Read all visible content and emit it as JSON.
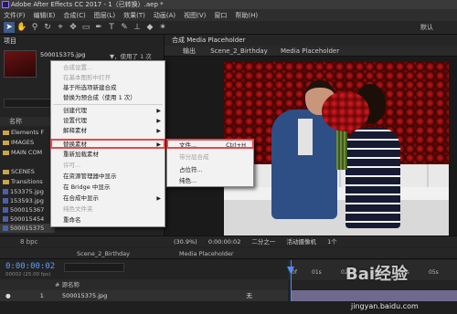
{
  "app": {
    "title": "Adobe After Effects CC 2017 - 1（已转换）.aep *"
  },
  "menu": [
    "文件(F)",
    "编辑(E)",
    "合成(C)",
    "图层(L)",
    "效果(T)",
    "动画(A)",
    "视图(V)",
    "窗口",
    "帮助(H)"
  ],
  "toolbar": {
    "workspace": "默认"
  },
  "project": {
    "tab": "项目",
    "item_name": "500015375.jpg",
    "item_usage": "▼，使用了 1 次",
    "column_name": "名称",
    "rows": [
      "Elements F",
      "IMAGES",
      "MAIN COM",
      "SCENES",
      "Transitions",
      "153375.jpg",
      "153593.jpg",
      "500015367",
      "500015454",
      "500015375"
    ],
    "footer_bpc": "8 bpc"
  },
  "composition": {
    "header": "合成 Media Placeholder",
    "sub_output": "输出",
    "sub_scene": "Scene_2_Birthday",
    "sub_media": "Media Placeholder",
    "footer_zoom": "(30.9%)",
    "footer_time": "0:00:00:02",
    "footer_quarter": "二分之一",
    "footer_camera": "活动摄像机",
    "footer_views": "1个"
  },
  "context_menu": {
    "items": [
      {
        "label": "合成设置...",
        "disabled": true
      },
      {
        "label": "在基本图形中打开",
        "disabled": true
      },
      {
        "label": "基于所选项新建合成",
        "disabled": false
      },
      {
        "label": "替换为预合成（使用 1 次）",
        "disabled": false
      },
      {
        "label": "创建代理",
        "disabled": false,
        "submenu": true
      },
      {
        "label": "设置代理",
        "disabled": false,
        "submenu": true
      },
      {
        "label": "解释素材",
        "disabled": false,
        "submenu": true
      },
      {
        "label": "替换素材",
        "disabled": false,
        "submenu": true,
        "highlighted": true
      },
      {
        "label": "重新加载素材",
        "disabled": false
      },
      {
        "label": "许可...",
        "disabled": true
      },
      {
        "label": "在资源管理器中显示",
        "disabled": false
      },
      {
        "label": "在 Bridge 中显示",
        "disabled": false
      },
      {
        "label": "在合成中显示",
        "disabled": false,
        "submenu": true
      },
      {
        "label": "纯色文件夹",
        "disabled": true
      },
      {
        "label": "重命名",
        "disabled": false
      }
    ]
  },
  "submenu": {
    "items": [
      {
        "label": "文件...",
        "shortcut": "Ctrl+H",
        "disabled": false,
        "highlighted": true
      },
      {
        "label": "带分层合成",
        "shortcut": "",
        "disabled": true
      },
      {
        "label": "占位符...",
        "shortcut": "",
        "disabled": false
      },
      {
        "label": "纯色...",
        "shortcut": "",
        "disabled": false
      }
    ]
  },
  "timeline": {
    "tabs": [
      "Scene_2_Birthday",
      "Media Placeholder"
    ],
    "timecode": "0:00:00:02",
    "timecode_sub": "00002 (25.00 fps)",
    "ruler": [
      "0f",
      "01s",
      "02s",
      "03s",
      "04s",
      "05s"
    ],
    "layer_header": "# 源名称",
    "layer_num": "1",
    "layer_name": "500015375.jpg",
    "layer_mode": "无"
  },
  "watermark": {
    "text": "Bai经验",
    "url": "jingyan.baidu.com"
  },
  "colors": {
    "accent": "#4a90ff",
    "highlight_box": "#e8474a",
    "layer_bar": "#6f6a8d"
  }
}
